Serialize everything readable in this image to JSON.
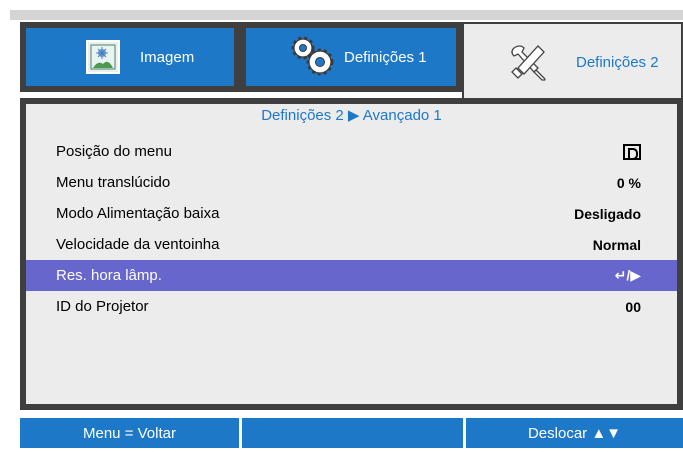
{
  "tabs": [
    {
      "label": "Imagem",
      "icon": "picture-icon"
    },
    {
      "label": "Definições 1",
      "icon": "gears-icon"
    },
    {
      "label": "Definições 2",
      "icon": "tools-icon"
    }
  ],
  "breadcrumb": "Definições 2 ▶ Avançado 1",
  "rows": [
    {
      "label": "Posição do menu",
      "value": ""
    },
    {
      "label": "Menu translúcido",
      "value": "0 %"
    },
    {
      "label": "Modo Alimentação baixa",
      "value": "Desligado"
    },
    {
      "label": "Velocidade da ventoinha",
      "value": "Normal"
    },
    {
      "label": "Res. hora lâmp.",
      "value": "↵/▶"
    },
    {
      "label": "ID do Projetor",
      "value": "00"
    }
  ],
  "footer": {
    "left": "Menu = Voltar",
    "middle": "",
    "right": "Deslocar ▲▼"
  },
  "colors": {
    "accent": "#1e78c8",
    "selected_row": "#6666cc",
    "frame": "#3f3f3f",
    "panel": "#ececec"
  }
}
